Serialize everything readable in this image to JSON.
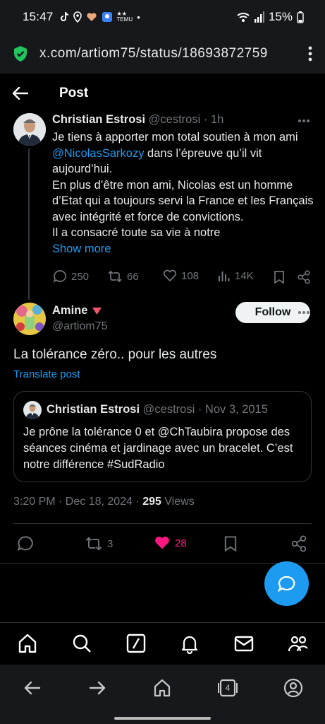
{
  "status_bar": {
    "time": "15:47",
    "battery": "15%"
  },
  "browser": {
    "url": "x.com/artiom75/status/18693872759"
  },
  "header": {
    "title": "Post"
  },
  "parent_tweet": {
    "name": "Christian Estrosi",
    "handle": "@cestrosi",
    "time": "· 1h",
    "text_1": "Je tiens à apporter mon total soutien à mon ami ",
    "mention": "@NicolasSarkozy",
    "text_2": " dans l’épreuve qu’il vit aujourd’hui.",
    "text_3": "En plus d’être mon ami, Nicolas est un homme d’Etat qui a toujours servi la France et les Français avec intégrité et force de convictions.",
    "text_4": "Il a consacré toute sa vie à notre",
    "show_more": "Show more",
    "replies": "250",
    "reposts": "66",
    "likes": "108",
    "views": "14K"
  },
  "main_tweet": {
    "name": "Amine",
    "handle": "@artiom75",
    "follow_label": "Follow",
    "text": "La tolérance zéro.. pour les autres",
    "translate": "Translate post",
    "quote": {
      "name": "Christian Estrosi",
      "handle": "@cestrosi",
      "date": "· Nov 3, 2015",
      "text": "Je prône la tolérance 0 et @ChTaubira propose des séances cinéma et jardinage avec un bracelet. C’est notre différence #SudRadio"
    },
    "timestamp": "3:20 PM · Dec 18, 2024 · ",
    "views_count": "295",
    "views_label": " Views",
    "reposts": "3",
    "likes": "28"
  },
  "browser_nav": {
    "tabs_count": "4"
  },
  "colors": {
    "accent": "#1d9bf0",
    "like": "#f91880",
    "muted": "#71767b",
    "background": "#000000"
  }
}
